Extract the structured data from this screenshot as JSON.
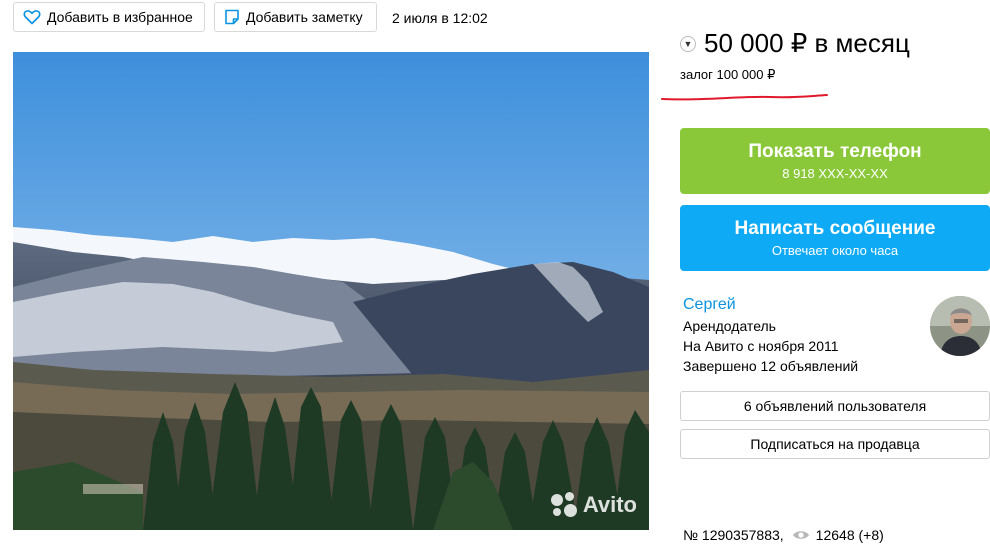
{
  "toolbar": {
    "favorite_label": "Добавить в избранное",
    "note_label": "Добавить заметку",
    "date": "2 июля в 12:02"
  },
  "listing": {
    "price": "50 000 ₽ в месяц",
    "deposit": "залог 100 000 ₽",
    "number": "№ 1290357883,",
    "views": "12648 (+8)"
  },
  "contact": {
    "phone_label": "Показать телефон",
    "phone_number": "8 918 XXX-XX-XX",
    "message_label": "Написать сообщение",
    "response_time": "Отвечает около часа"
  },
  "seller": {
    "name": "Сергей",
    "role": "Арендодатель",
    "since": "На Авито с ноября 2011",
    "completed": "Завершено 12 объявлений",
    "listings_button": "6 объявлений пользователя",
    "subscribe_button": "Подписаться на продавца"
  },
  "photo": {
    "watermark": "Avito"
  },
  "colors": {
    "green": "#8ac83a",
    "blue": "#0eaaf5",
    "link": "#0a94e0",
    "underline": "#e0192d"
  },
  "icons": {
    "favorite": "heart-icon",
    "note": "note-icon",
    "price": "chevron-down-icon",
    "views": "eye-icon"
  }
}
